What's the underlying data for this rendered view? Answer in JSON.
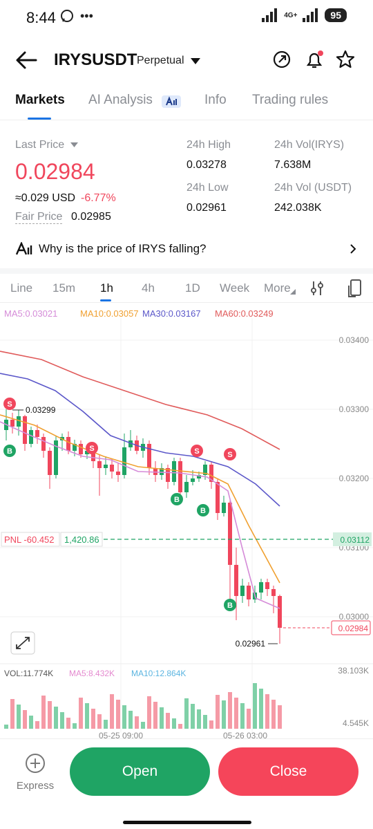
{
  "status": {
    "time": "8:44",
    "network": "4G+",
    "battery": "95"
  },
  "header": {
    "symbol": "IRYSUSDT",
    "contract_type": "Perpetual"
  },
  "tabs": [
    {
      "label": "Markets",
      "active": true
    },
    {
      "label": "AI Analysis",
      "active": false
    },
    {
      "label": "Info",
      "active": false
    },
    {
      "label": "Trading rules",
      "active": false
    }
  ],
  "price": {
    "last_price_label": "Last Price",
    "last_price": "0.02984",
    "usd_value": "≈0.029 USD",
    "change": "-6.77%",
    "fair_price_label": "Fair Price",
    "fair_price": "0.02985",
    "high_label": "24h High",
    "high": "0.03278",
    "low_label": "24h Low",
    "low": "0.02961",
    "vol_irys_label": "24h Vol(IRYS)",
    "vol_irys": "7.638M",
    "vol_usdt_label": "24h Vol (USDT)",
    "vol_usdt": "242.038K"
  },
  "ai_question": "Why is the price of IRYS falling?",
  "intervals": [
    {
      "label": "Line",
      "active": false
    },
    {
      "label": "15m",
      "active": false
    },
    {
      "label": "1h",
      "active": true
    },
    {
      "label": "4h",
      "active": false
    },
    {
      "label": "1D",
      "active": false
    },
    {
      "label": "Week",
      "active": false
    },
    {
      "label": "More",
      "active": false
    }
  ],
  "ma_legend": {
    "ma5": "MA5:0.03021",
    "ma10": "MA10:0.03057",
    "ma30": "MA30:0.03167",
    "ma60": "MA60:0.03249"
  },
  "chart": {
    "y_ticks": [
      "0.03400",
      "0.03300",
      "0.03200",
      "0.03100",
      "0.03000"
    ],
    "high_marker": "0.03299",
    "low_marker": "0.02961",
    "pnl_label": "PNL -60.452",
    "position_value": "1,420.86",
    "entry_price": "0.03112",
    "current_price": "0.02984",
    "x_labels": [
      "05-25 09:00",
      "05-26 03:00"
    ],
    "colors": {
      "up": "#1fa464",
      "down": "#f0465c",
      "ma5": "#d58bd8",
      "ma10": "#f0a030",
      "ma30": "#5b57c9",
      "ma60": "#e05a5a"
    }
  },
  "volume": {
    "vol_label": "VOL:11.774K",
    "ma5_label": "MA5:8.432K",
    "ma10_label": "MA10:12.864K",
    "max": "38.103K",
    "min": "4.545K"
  },
  "bottom": {
    "express": "Express",
    "open": "Open",
    "close": "Close"
  }
}
